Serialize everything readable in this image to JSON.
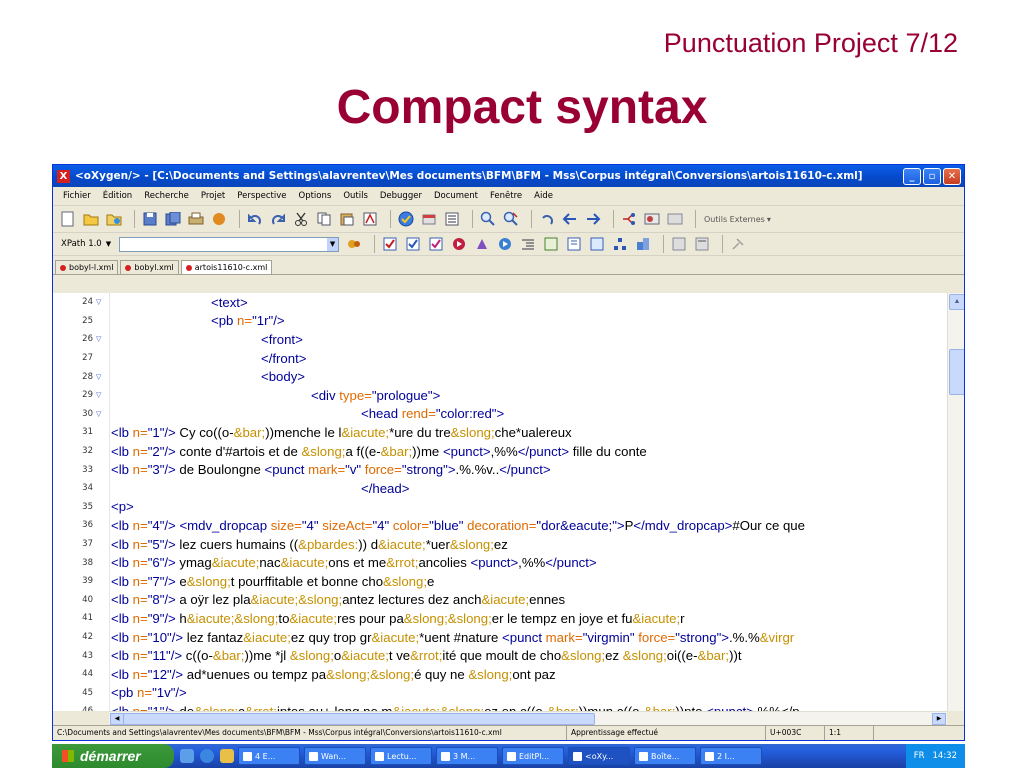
{
  "slide": {
    "subtitle": "Punctuation Project 7/12",
    "title": "Compact syntax"
  },
  "window": {
    "title": "<oXygen/> - [C:\\Documents and Settings\\alavrentev\\Mes documents\\BFM\\BFM - Mss\\Corpus intégral\\Conversions\\artois11610-c.xml]",
    "logo": "X",
    "btn_min": "_",
    "btn_max": "▫",
    "btn_close": "✕"
  },
  "menu": [
    "Fichier",
    "Édition",
    "Recherche",
    "Projet",
    "Perspective",
    "Options",
    "Outils",
    "Debugger",
    "Document",
    "Fenêtre",
    "Aide"
  ],
  "toolbar": {
    "external_tools": "Outils Externes"
  },
  "xpath": {
    "version": "XPath 1.0",
    "value": ""
  },
  "tabs": [
    {
      "label": "bobyl-l.xml",
      "active": false
    },
    {
      "label": "bobyl.xml",
      "active": false
    },
    {
      "label": "artois11610-c.xml",
      "active": true
    }
  ],
  "editor": {
    "lines": [
      {
        "n": "24",
        "fold": true
      },
      {
        "n": "25",
        "fold": false
      },
      {
        "n": "26",
        "fold": true
      },
      {
        "n": "27",
        "fold": false
      },
      {
        "n": "28",
        "fold": true
      },
      {
        "n": "29",
        "fold": true
      },
      {
        "n": "30",
        "fold": true
      },
      {
        "n": "31",
        "fold": false
      },
      {
        "n": "32",
        "fold": false
      },
      {
        "n": "33",
        "fold": false
      },
      {
        "n": "34",
        "fold": false
      },
      {
        "n": "35",
        "fold": false
      },
      {
        "n": "36",
        "fold": false
      },
      {
        "n": "37",
        "fold": false
      },
      {
        "n": "38",
        "fold": false
      },
      {
        "n": "39",
        "fold": false
      },
      {
        "n": "40",
        "fold": false
      },
      {
        "n": "41",
        "fold": false
      },
      {
        "n": "42",
        "fold": false
      },
      {
        "n": "43",
        "fold": false
      },
      {
        "n": "44",
        "fold": false
      },
      {
        "n": "45",
        "fold": false
      },
      {
        "n": "46",
        "fold": false
      }
    ],
    "code": [
      [
        [
          "t",
          "<text>"
        ]
      ],
      [
        [
          "t",
          "<pb "
        ],
        [
          "a",
          "n="
        ],
        [
          "v",
          "\"1r\""
        ],
        [
          "t",
          "/>"
        ]
      ],
      [
        [
          "t",
          "<front>"
        ]
      ],
      [
        [
          "t",
          "</front>"
        ]
      ],
      [
        [
          "t",
          "<body>"
        ]
      ],
      [
        [
          "t",
          "<div "
        ],
        [
          "a",
          "type="
        ],
        [
          "v",
          "\"prologue\""
        ],
        [
          "t",
          ">"
        ]
      ],
      [
        [
          "t",
          "<head "
        ],
        [
          "a",
          "rend="
        ],
        [
          "v",
          "\"color:red\""
        ],
        [
          "t",
          ">"
        ]
      ],
      [
        [
          "t",
          "<lb "
        ],
        [
          "a",
          "n="
        ],
        [
          "v",
          "\"1\""
        ],
        [
          "t",
          "/>"
        ],
        [
          "x",
          " Cy co((o-"
        ],
        [
          "e",
          "&bar;"
        ],
        [
          "x",
          "))menche le l"
        ],
        [
          "e",
          "&iacute;"
        ],
        [
          "x",
          "*ure du tre"
        ],
        [
          "e",
          "&slong;"
        ],
        [
          "x",
          "che*ualereux"
        ]
      ],
      [
        [
          "t",
          "<lb "
        ],
        [
          "a",
          "n="
        ],
        [
          "v",
          "\"2\""
        ],
        [
          "t",
          "/>"
        ],
        [
          "x",
          " conte d'#artois et de "
        ],
        [
          "e",
          "&slong;"
        ],
        [
          "x",
          "a f((e-"
        ],
        [
          "e",
          "&bar;"
        ],
        [
          "x",
          "))me "
        ],
        [
          "t",
          "<punct>"
        ],
        [
          "x",
          ",%%"
        ],
        [
          "t",
          "</punct>"
        ],
        [
          "x",
          " fille du conte"
        ]
      ],
      [
        [
          "t",
          "<lb "
        ],
        [
          "a",
          "n="
        ],
        [
          "v",
          "\"3\""
        ],
        [
          "t",
          "/>"
        ],
        [
          "x",
          " de Boulongne "
        ],
        [
          "t",
          "<punct "
        ],
        [
          "a",
          "mark="
        ],
        [
          "v",
          "\"v\" "
        ],
        [
          "a",
          "force="
        ],
        [
          "v",
          "\"strong\""
        ],
        [
          "t",
          ">"
        ],
        [
          "x",
          ".%.%v.."
        ],
        [
          "t",
          "</punct>"
        ]
      ],
      [
        [
          "t",
          "</head>"
        ]
      ],
      [
        [
          "t",
          "<p>"
        ]
      ],
      [
        [
          "t",
          "<lb "
        ],
        [
          "a",
          "n="
        ],
        [
          "v",
          "\"4\""
        ],
        [
          "t",
          "/>"
        ],
        [
          "x",
          " "
        ],
        [
          "t",
          "<mdv_dropcap "
        ],
        [
          "a",
          "size="
        ],
        [
          "v",
          "\"4\" "
        ],
        [
          "a",
          "sizeAct="
        ],
        [
          "v",
          "\"4\" "
        ],
        [
          "a",
          "color="
        ],
        [
          "v",
          "\"blue\" "
        ],
        [
          "a",
          "decoration="
        ],
        [
          "v",
          "\"dor&eacute;\""
        ],
        [
          "t",
          ">"
        ],
        [
          "x",
          "P"
        ],
        [
          "t",
          "</mdv_dropcap>"
        ],
        [
          "x",
          "#Our ce que"
        ]
      ],
      [
        [
          "t",
          "<lb "
        ],
        [
          "a",
          "n="
        ],
        [
          "v",
          "\"5\""
        ],
        [
          "t",
          "/>"
        ],
        [
          "x",
          " lez cuers humains (("
        ],
        [
          "e",
          "&pbardes:"
        ],
        [
          "x",
          ")) d"
        ],
        [
          "e",
          "&iacute;"
        ],
        [
          "x",
          "*uer"
        ],
        [
          "e",
          "&slong;"
        ],
        [
          "x",
          "ez"
        ]
      ],
      [
        [
          "t",
          "<lb "
        ],
        [
          "a",
          "n="
        ],
        [
          "v",
          "\"6\""
        ],
        [
          "t",
          "/>"
        ],
        [
          "x",
          " ymag"
        ],
        [
          "e",
          "&iacute;"
        ],
        [
          "x",
          "nac"
        ],
        [
          "e",
          "&iacute;"
        ],
        [
          "x",
          "ons et me"
        ],
        [
          "e",
          "&rrot;"
        ],
        [
          "x",
          "ancolies "
        ],
        [
          "t",
          "<punct>"
        ],
        [
          "x",
          ",%%"
        ],
        [
          "t",
          "</punct>"
        ]
      ],
      [
        [
          "t",
          "<lb "
        ],
        [
          "a",
          "n="
        ],
        [
          "v",
          "\"7\""
        ],
        [
          "t",
          "/>"
        ],
        [
          "x",
          " e"
        ],
        [
          "e",
          "&slong;"
        ],
        [
          "x",
          "t pourffitable et bonne cho"
        ],
        [
          "e",
          "&slong;"
        ],
        [
          "x",
          "e"
        ]
      ],
      [
        [
          "t",
          "<lb "
        ],
        [
          "a",
          "n="
        ],
        [
          "v",
          "\"8\""
        ],
        [
          "t",
          "/>"
        ],
        [
          "x",
          " a oÿr lez pla"
        ],
        [
          "e",
          "&iacute;&slong;"
        ],
        [
          "x",
          "antez lectures dez anch"
        ],
        [
          "e",
          "&iacute;"
        ],
        [
          "x",
          "ennes"
        ]
      ],
      [
        [
          "t",
          "<lb "
        ],
        [
          "a",
          "n="
        ],
        [
          "v",
          "\"9\""
        ],
        [
          "t",
          "/>"
        ],
        [
          "x",
          " h"
        ],
        [
          "e",
          "&iacute;&slong;"
        ],
        [
          "x",
          "to"
        ],
        [
          "e",
          "&iacute;"
        ],
        [
          "x",
          "res pour pa"
        ],
        [
          "e",
          "&slong;&slong;"
        ],
        [
          "x",
          "er le tempz en joye et fu"
        ],
        [
          "e",
          "&iacute;"
        ],
        [
          "x",
          "r"
        ]
      ],
      [
        [
          "t",
          "<lb "
        ],
        [
          "a",
          "n="
        ],
        [
          "v",
          "\"10\""
        ],
        [
          "t",
          "/>"
        ],
        [
          "x",
          " lez fantaz"
        ],
        [
          "e",
          "&iacute;"
        ],
        [
          "x",
          "ez quy trop gr"
        ],
        [
          "e",
          "&iacute;"
        ],
        [
          "x",
          "*uent #nature "
        ],
        [
          "t",
          "<punct "
        ],
        [
          "a",
          "mark="
        ],
        [
          "v",
          "\"virgmin\" "
        ],
        [
          "a",
          "force="
        ],
        [
          "v",
          "\"strong\""
        ],
        [
          "t",
          ">"
        ],
        [
          "x",
          ".%.%"
        ],
        [
          "e",
          "&virgr"
        ]
      ],
      [
        [
          "t",
          "<lb "
        ],
        [
          "a",
          "n="
        ],
        [
          "v",
          "\"11\""
        ],
        [
          "t",
          "/>"
        ],
        [
          "x",
          " c((o-"
        ],
        [
          "e",
          "&bar;"
        ],
        [
          "x",
          "))me *jl "
        ],
        [
          "e",
          "&slong;"
        ],
        [
          "x",
          "o"
        ],
        [
          "e",
          "&iacute;"
        ],
        [
          "x",
          "t ve"
        ],
        [
          "e",
          "&rrot;"
        ],
        [
          "x",
          "ité que moult de cho"
        ],
        [
          "e",
          "&slong;"
        ],
        [
          "x",
          "ez "
        ],
        [
          "e",
          "&slong;"
        ],
        [
          "x",
          "oi((e-"
        ],
        [
          "e",
          "&bar;"
        ],
        [
          "x",
          "))t"
        ]
      ],
      [
        [
          "t",
          "<lb "
        ],
        [
          "a",
          "n="
        ],
        [
          "v",
          "\"12\""
        ],
        [
          "t",
          "/>"
        ],
        [
          "x",
          " ad*uenues ou tempz pa"
        ],
        [
          "e",
          "&slong;&slong;"
        ],
        [
          "x",
          "é quy ne "
        ],
        [
          "e",
          "&slong;"
        ],
        [
          "x",
          "ont paz"
        ]
      ],
      [
        [
          "t",
          "<pb "
        ],
        [
          "a",
          "n="
        ],
        [
          "v",
          "\"1v\""
        ],
        [
          "t",
          "/>"
        ]
      ],
      [
        [
          "t",
          "<lb "
        ],
        [
          "a",
          "n="
        ],
        [
          "v",
          "\"1\""
        ],
        [
          "t",
          "/>"
        ],
        [
          "x",
          " de"
        ],
        [
          "e",
          "&slong;"
        ],
        [
          "x",
          "c"
        ],
        [
          "e",
          "&rrot;"
        ],
        [
          "x",
          "iptes au+ long ne m"
        ],
        [
          "e",
          "&iacute;&slong;"
        ],
        [
          "x",
          "ez en c((o-"
        ],
        [
          "e",
          "&bar;"
        ],
        [
          "x",
          "))mun c((o-"
        ],
        [
          "e",
          "&bar;"
        ],
        [
          "x",
          "))pte "
        ],
        [
          "t",
          "<punct>"
        ],
        [
          "x",
          ",%%</p"
        ]
      ]
    ]
  },
  "status": {
    "path": "C:\\Documents and Settings\\alavrentev\\Mes documents\\BFM\\BFM - Mss\\Corpus intégral\\Conversions\\artois11610-c.xml",
    "message": "Apprentissage effectué",
    "char": "U+003C",
    "pos": "1:1"
  },
  "taskbar": {
    "start": "démarrer",
    "tasks": [
      "4 E...",
      "Wan...",
      "Lectu...",
      "3 M...",
      "EditPl...",
      "<oXy...",
      "Boîte...",
      "2 I..."
    ],
    "lang": "FR",
    "time": "14:32"
  }
}
